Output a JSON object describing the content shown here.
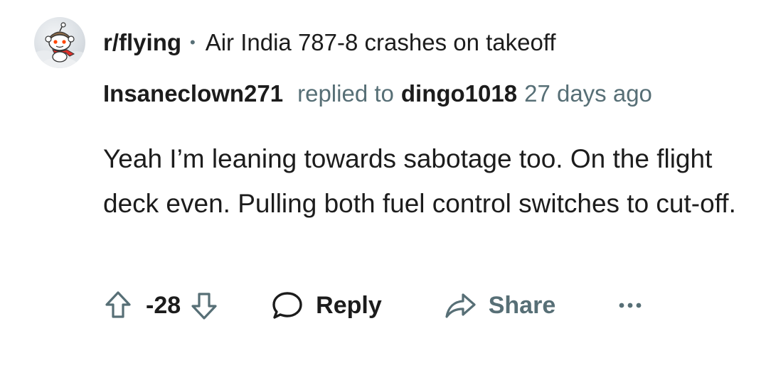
{
  "header": {
    "subreddit": "r/flying",
    "separator": "•",
    "post_title": "Air India 787-8 crashes on takeoff"
  },
  "comment": {
    "author": "Insaneclown271",
    "replied_to_label": "replied to",
    "parent_author": "dingo1018",
    "time": "27 days ago",
    "body": "Yeah I’m leaning towards sabotage too. On the flight deck even. Pulling both fuel control switches to cut-off."
  },
  "actions": {
    "score": "-28",
    "reply_label": "Reply",
    "share_label": "Share",
    "more_label": "•••"
  },
  "icons": {
    "avatar": "snoo-avatar-icon",
    "upvote": "arrow-up-outline-icon",
    "downvote": "arrow-down-outline-icon",
    "reply": "speech-bubble-icon",
    "share": "share-arrow-icon",
    "more": "ellipsis-icon"
  },
  "colors": {
    "text_primary": "#1c1c1c",
    "text_secondary": "#576f76",
    "background": "#ffffff"
  }
}
